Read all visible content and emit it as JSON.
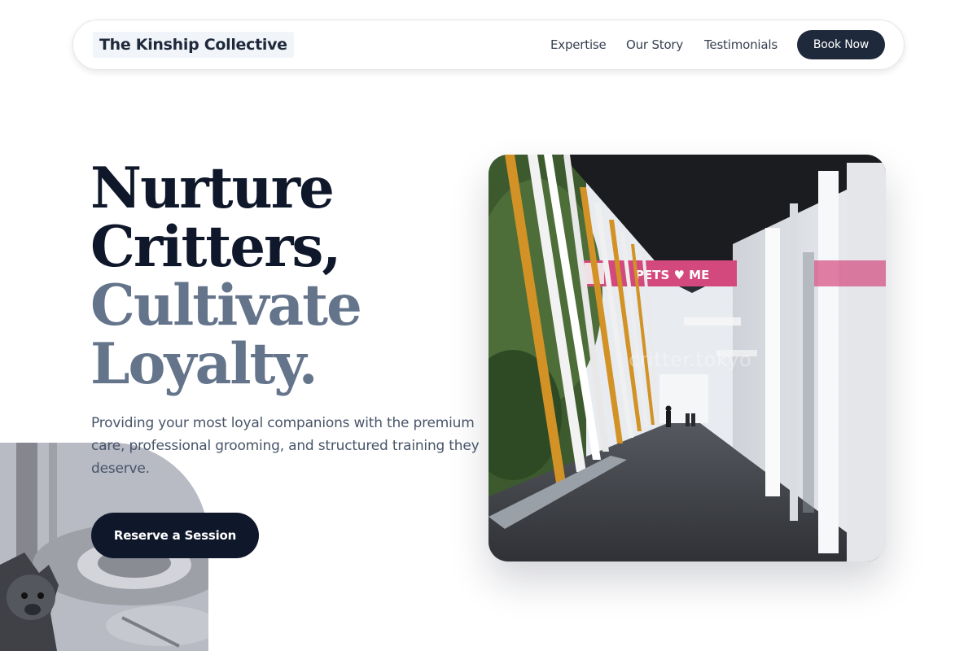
{
  "nav": {
    "brand": "The Kinship Collective",
    "links": [
      "Expertise",
      "Our Story",
      "Testimonials"
    ],
    "cta": "Book Now"
  },
  "hero": {
    "headline_line1": "Nurture",
    "headline_line2": "Critters,",
    "headline_line3": "Cultivate",
    "headline_line4": "Loyalty.",
    "description": "Providing your most loyal companions with the premium care, professional grooming, and structured training they deserve.",
    "cta": "Reserve a Session"
  },
  "photo": {
    "watermark": "critter.tokyo",
    "sign_text": "PETS ♥ ME"
  },
  "colors": {
    "primary": "#0f172a",
    "muted_heading": "#64748b",
    "body_text": "#475569",
    "nav_button": "#1e293b"
  }
}
